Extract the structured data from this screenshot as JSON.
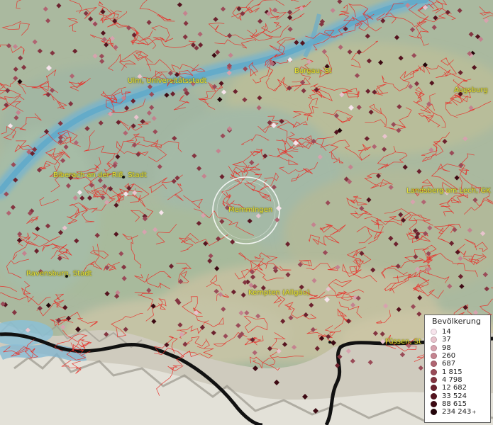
{
  "map": {
    "cities": [
      {
        "name": "Ulm, Universitätsstadt",
        "id": "ulm"
      },
      {
        "name": "Burgau, St",
        "id": "burgau"
      },
      {
        "name": "Augsburg",
        "id": "augsburg"
      },
      {
        "name": "Biberach an der Riß, Stadt",
        "id": "biberach"
      },
      {
        "name": "Memmingen",
        "id": "memmingen"
      },
      {
        "name": "Landsberg am Lech, GK",
        "id": "landsberg"
      },
      {
        "name": "Ravensburg, Stadt",
        "id": "ravensburg"
      },
      {
        "name": "Kempten (Allgäu)",
        "id": "kempten"
      },
      {
        "name": "Füssen, St",
        "id": "fuessen"
      }
    ]
  },
  "legend": {
    "title": "Bevölkerung",
    "items": [
      {
        "label": "14",
        "color": "#f7e4ec"
      },
      {
        "label": "37",
        "color": "#e8c3cd"
      },
      {
        "label": "98",
        "color": "#d7a2ae"
      },
      {
        "label": "260",
        "color": "#c4838f"
      },
      {
        "label": "687",
        "color": "#b06572"
      },
      {
        "label": "1 815",
        "color": "#9a4b58"
      },
      {
        "label": "4 798",
        "color": "#843541"
      },
      {
        "label": "12 682",
        "color": "#6c222e"
      },
      {
        "label": "33 524",
        "color": "#55141f"
      },
      {
        "label": "88 615",
        "color": "#3d0a13"
      },
      {
        "label": "234 243",
        "color": "#24050a",
        "overflow": "+"
      }
    ]
  }
}
